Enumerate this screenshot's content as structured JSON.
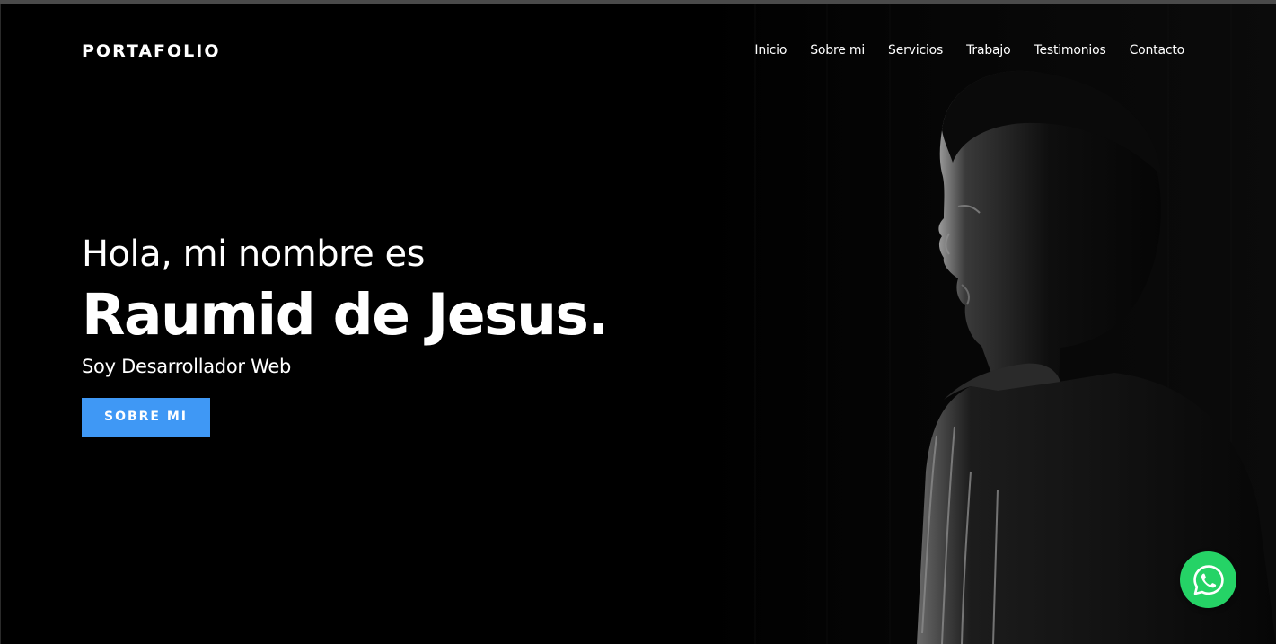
{
  "header": {
    "logo": "PORTAFOLIO",
    "nav": [
      {
        "label": "Inicio"
      },
      {
        "label": "Sobre mi"
      },
      {
        "label": "Servicios"
      },
      {
        "label": "Trabajo"
      },
      {
        "label": "Testimonios"
      },
      {
        "label": "Contacto"
      }
    ]
  },
  "hero": {
    "greeting": "Hola, mi nombre es",
    "name": "Raumid de Jesus.",
    "role": "Soy Desarrollador Web",
    "cta_label": "SOBRE MI"
  },
  "floating": {
    "whatsapp_icon": "whatsapp-icon"
  },
  "colors": {
    "background": "#000000",
    "accent": "#3f98f5",
    "whatsapp": "#25d366",
    "text": "#ffffff"
  }
}
